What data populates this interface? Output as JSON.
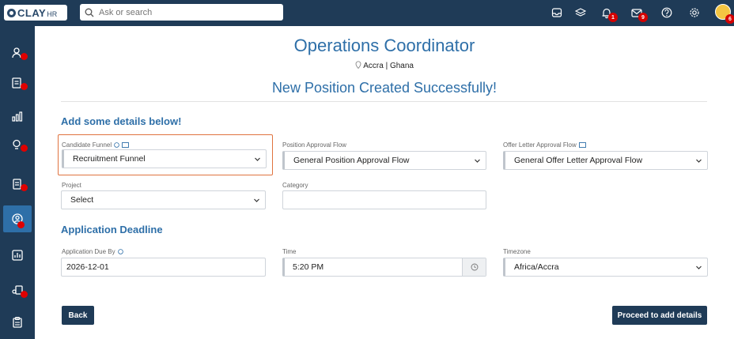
{
  "topbar": {
    "logo_text": "CLAY",
    "logo_sub": "HR",
    "search_placeholder": "Ask or search",
    "notifications_count": "1",
    "messages_count": "9",
    "avatar_count": "6"
  },
  "page": {
    "title": "Operations Coordinator",
    "location": "Accra | Ghana",
    "success_message": "New Position Created Successfully!"
  },
  "details": {
    "heading": "Add some details below!",
    "candidate_funnel": {
      "label": "Candidate Funnel",
      "value": "Recruitment Funnel"
    },
    "position_approval": {
      "label": "Position Approval Flow",
      "value": "General Position Approval Flow"
    },
    "offer_letter_approval": {
      "label": "Offer Letter Approval Flow",
      "value": "General Offer Letter Approval Flow"
    },
    "project": {
      "label": "Project",
      "value": "Select"
    },
    "category": {
      "label": "Category",
      "value": ""
    }
  },
  "deadline": {
    "heading": "Application Deadline",
    "due_by": {
      "label": "Application Due By",
      "value": "2026-12-01"
    },
    "time": {
      "label": "Time",
      "value": "5:20 PM"
    },
    "timezone": {
      "label": "Timezone",
      "value": "Africa/Accra"
    }
  },
  "actions": {
    "back_label": "Back",
    "proceed_label": "Proceed to add details"
  },
  "colors": {
    "navy": "#1f3b57",
    "accent_blue": "#2e6fa8",
    "highlight_orange": "#e0733f",
    "badge_red": "#d40000"
  }
}
